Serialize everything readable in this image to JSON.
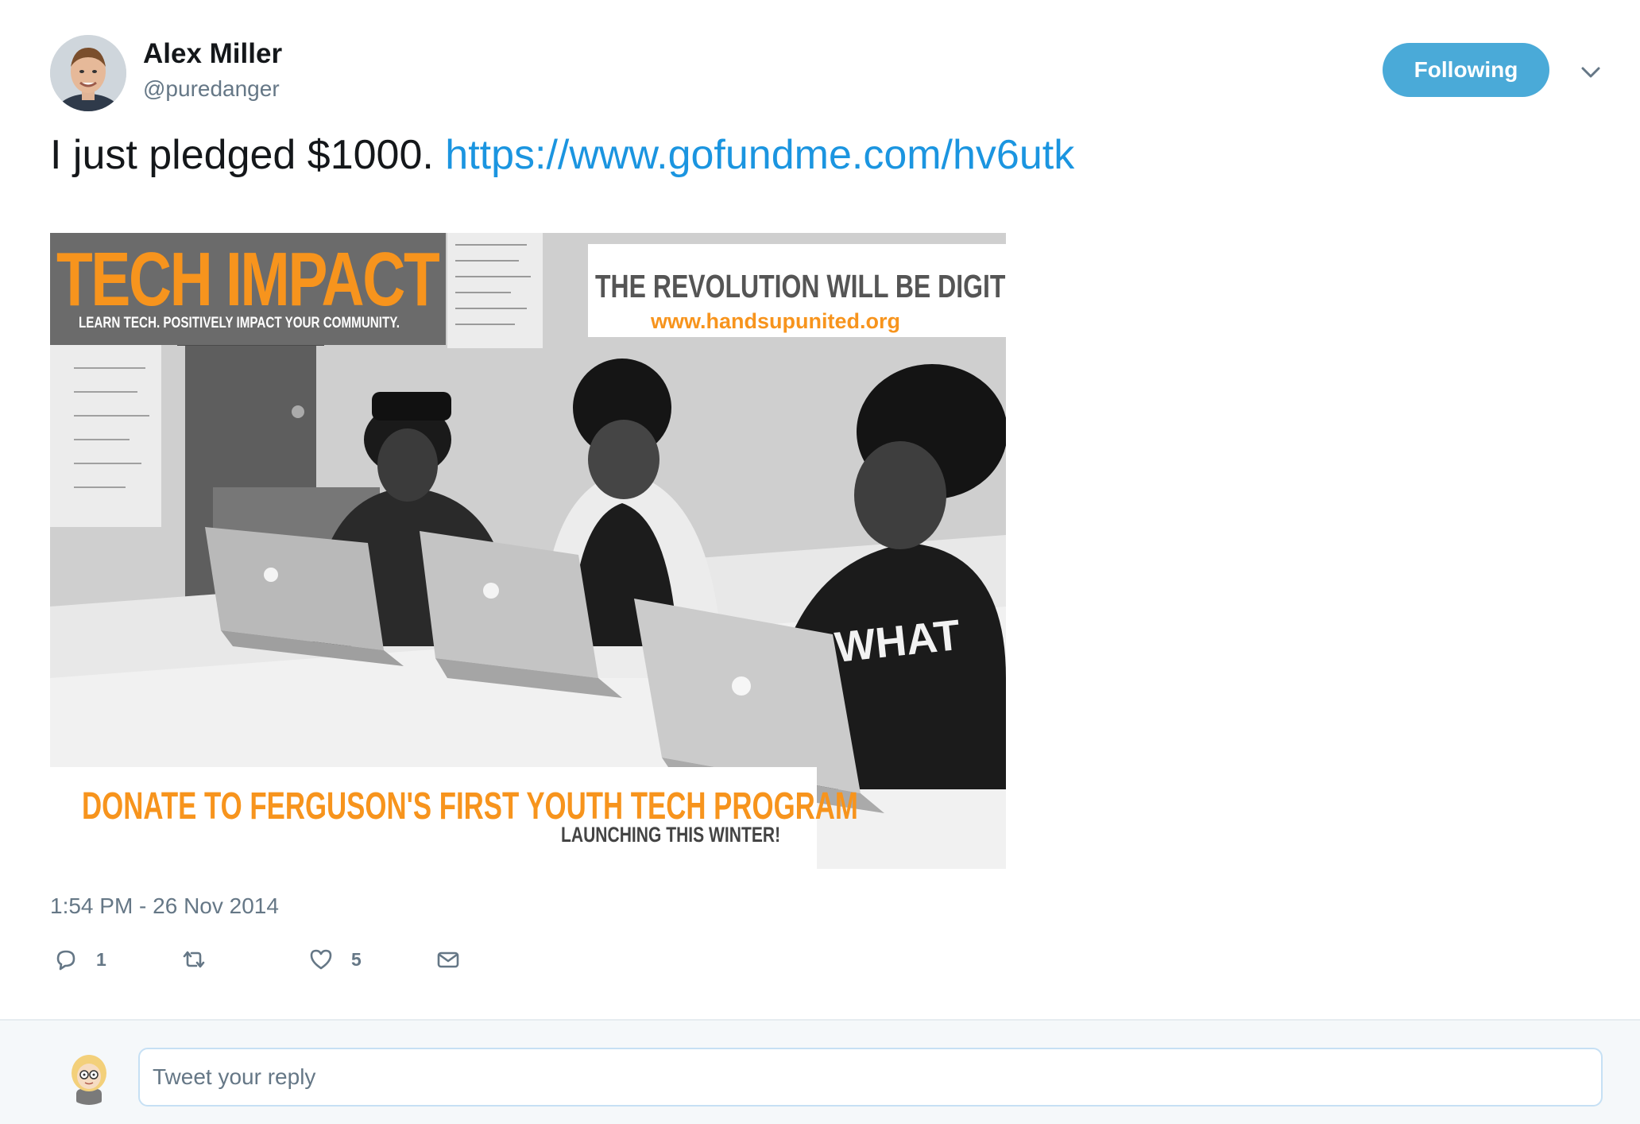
{
  "tweet": {
    "author": {
      "display_name": "Alex Miller",
      "handle": "@puredanger",
      "avatar_icon": "avatar-photo"
    },
    "follow_button_label": "Following",
    "caret_icon": "chevron-down-icon",
    "text": "I just pledged $1000.",
    "link": "https://www.gofundme.com/hv6utk",
    "media": {
      "headline": "TECH IMPACT",
      "tagline": "LEARN TECH. POSITIVELY IMPACT YOUR COMMUNITY.",
      "revolution": "THE REVOLUTION WILL BE DIGITIZED",
      "url": "www.handsupunited.org",
      "donate": "DONATE TO FERGUSON'S FIRST YOUTH TECH PROGRAM",
      "launching": "LAUNCHING THIS WINTER!"
    },
    "timestamp": "1:54 PM - 26 Nov 2014",
    "actions": {
      "reply_count": "1",
      "retweet_count": "",
      "like_count": "5"
    }
  },
  "reply": {
    "placeholder": "Tweet your reply"
  },
  "colors": {
    "accent": "#1b95e0",
    "follow_button": "#4aaad8",
    "muted": "#657786",
    "media_orange": "#f7941d"
  }
}
